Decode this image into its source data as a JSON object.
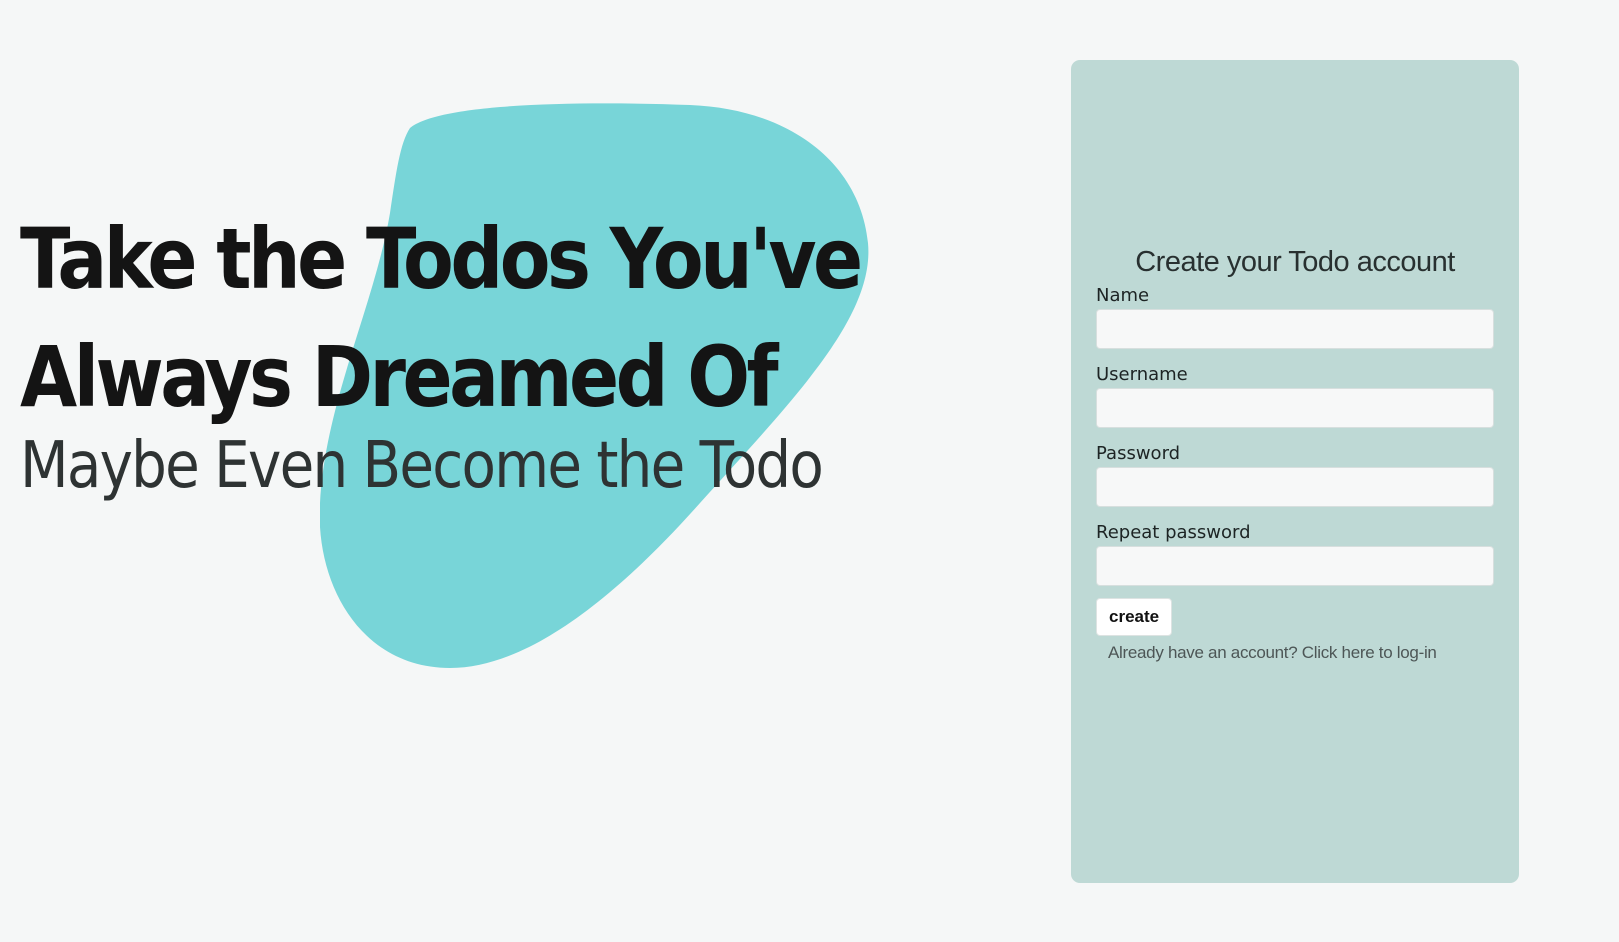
{
  "hero": {
    "title_line1": "Take the Todos You've",
    "title_line2": "Always Dreamed Of",
    "subtitle": "Maybe Even Become the Todo"
  },
  "form": {
    "heading": "Create your Todo account",
    "fields": [
      {
        "label": "Name",
        "value": "",
        "placeholder": ""
      },
      {
        "label": "Username",
        "value": "",
        "placeholder": ""
      },
      {
        "label": "Password",
        "value": "",
        "placeholder": ""
      },
      {
        "label": "Repeat password",
        "value": "",
        "placeholder": ""
      }
    ],
    "submit_label": "create",
    "login_link": "Already have an account? Click here to log-in"
  },
  "colors": {
    "background": "#f5f7f7",
    "blob": "#78d5d8",
    "card": "#bed9d5",
    "input": "#f7f8f8"
  }
}
